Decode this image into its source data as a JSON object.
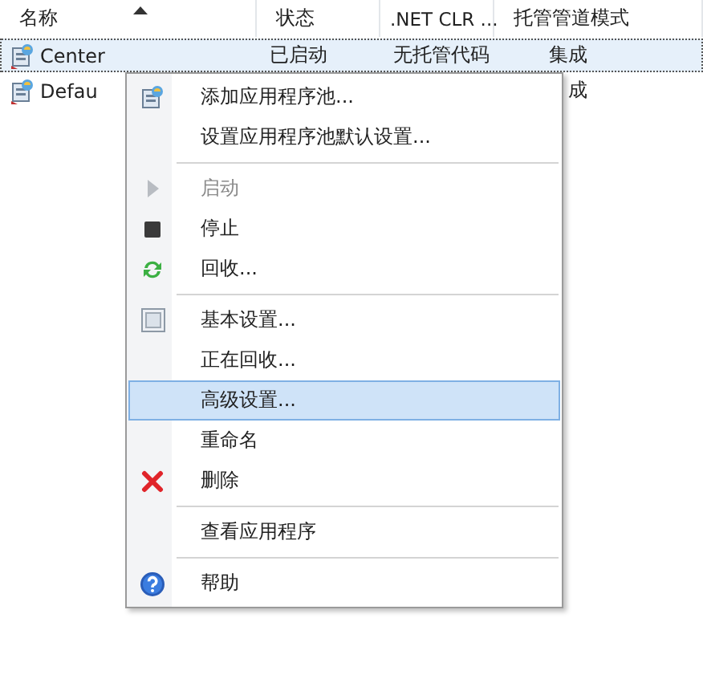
{
  "table": {
    "columns": [
      {
        "label": "名称",
        "sorted": true
      },
      {
        "label": "状态",
        "sorted": false
      },
      {
        "label": ".NET CLR ...",
        "sorted": false
      },
      {
        "label": "托管管道模式",
        "sorted": false
      }
    ],
    "rows": [
      {
        "cells": [
          "Center",
          "已启动",
          "无托管代码",
          "集成"
        ],
        "selected": true
      },
      {
        "cells": [
          "Defau",
          "",
          "",
          "成"
        ],
        "selected": false
      }
    ]
  },
  "context_menu": {
    "items": [
      {
        "kind": "pool",
        "label": "添加应用程序池...",
        "disabled": false,
        "selected": false
      },
      {
        "kind": "plain",
        "label": "设置应用程序池默认设置...",
        "disabled": false,
        "selected": false
      },
      {
        "kind": "separator"
      },
      {
        "kind": "start",
        "label": "启动",
        "disabled": true,
        "selected": false
      },
      {
        "kind": "stop",
        "label": "停止",
        "disabled": false,
        "selected": false
      },
      {
        "kind": "recycle",
        "label": "回收...",
        "disabled": false,
        "selected": false
      },
      {
        "kind": "separator"
      },
      {
        "kind": "settings",
        "label": "基本设置...",
        "disabled": false,
        "selected": false
      },
      {
        "kind": "plain",
        "label": "正在回收...",
        "disabled": false,
        "selected": false
      },
      {
        "kind": "plain",
        "label": "高级设置...",
        "disabled": false,
        "selected": true
      },
      {
        "kind": "plain",
        "label": "重命名",
        "disabled": false,
        "selected": false
      },
      {
        "kind": "delete",
        "label": "删除",
        "disabled": false,
        "selected": false
      },
      {
        "kind": "separator"
      },
      {
        "kind": "plain",
        "label": "查看应用程序",
        "disabled": false,
        "selected": false
      },
      {
        "kind": "separator"
      },
      {
        "kind": "help",
        "label": "帮助",
        "disabled": false,
        "selected": false
      }
    ]
  }
}
